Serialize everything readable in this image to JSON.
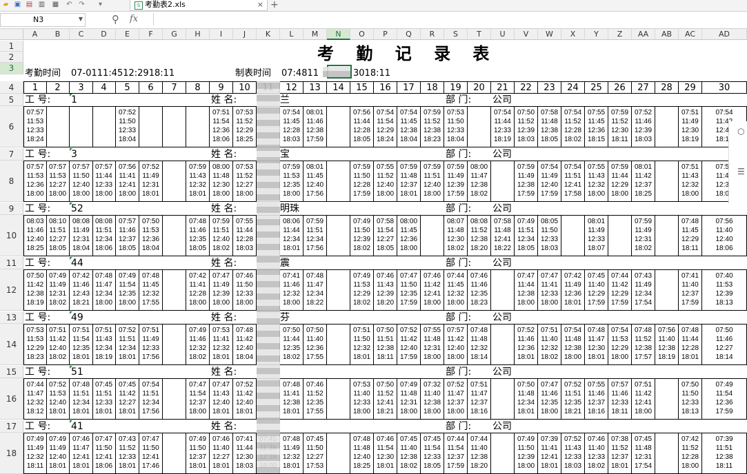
{
  "toolbar": {
    "icons": [
      "folder-open-icon",
      "save-icon",
      "export-icon",
      "print-icon",
      "print-preview-icon",
      "undo-icon",
      "redo-icon",
      "more-icon"
    ]
  },
  "tab": {
    "file_name": "考勤表2.xls",
    "close": "×",
    "add": "+"
  },
  "formula_bar": {
    "cell_ref": "N3",
    "fx": "fx",
    "value": ""
  },
  "columns": [
    "A",
    "B",
    "C",
    "D",
    "E",
    "F",
    "G",
    "H",
    "I",
    "J",
    "K",
    "L",
    "M",
    "N",
    "O",
    "P",
    "Q",
    "R",
    "S",
    "T",
    "U",
    "V",
    "W",
    "X",
    "Y",
    "Z",
    "AA",
    "AB",
    "AC",
    "AD"
  ],
  "selected_column": "N",
  "rows": [
    "1",
    "2",
    "3",
    "4",
    "5",
    "6",
    "7",
    "8",
    "9",
    "10",
    "11",
    "12",
    "13",
    "14",
    "15",
    "16",
    "17",
    "18"
  ],
  "selected_row": "3",
  "sheet": {
    "title": "考 勤 记 录 表",
    "attendance_time_label": "考勤时间",
    "attendance_time_value": "07-0111:4512:2918:11",
    "made_time_label": "制表时间",
    "made_time_value_a": "07:4811",
    "made_time_value_b": "3018:11",
    "days": [
      "1",
      "2",
      "3",
      "4",
      "5",
      "6",
      "7",
      "8",
      "9",
      "10",
      "11",
      "12",
      "13",
      "14",
      "15",
      "16",
      "17",
      "18",
      "19",
      "20",
      "21",
      "22",
      "23",
      "24",
      "25",
      "26",
      "27",
      "28",
      "29",
      "30"
    ],
    "emp_label": "工  号:",
    "name_label": "姓  名:",
    "dept_label": "部  门:",
    "dept_value": "公司",
    "employees": [
      {
        "id": "1",
        "name_tail": "兰",
        "punches": [
          "07:57\n11:53\n12:33\n18:24",
          "",
          "",
          "",
          "07:52\n11:50\n12:33\n18:04",
          "",
          "",
          "",
          "07:51\n11:54\n12:36\n18:06",
          "07:53\n11:52\n12:29\n18:25",
          "",
          "07:54\n11:45\n12:28\n18:03",
          "08:01\n11:46\n12:38\n17:59",
          "",
          "07:56\n11:44\n12:28\n18:05",
          "07:54\n11:54\n12:29\n18:24",
          "07:54\n11:45\n12:38\n18:04",
          "07:59\n11:52\n12:38\n18:23",
          "07:53\n11:50\n12:33\n18:04",
          "",
          "07:54\n11:44\n12:33\n18:19",
          "07:50\n11:52\n12:39\n18:03",
          "07:58\n11:48\n12:38\n18:05",
          "07:54\n11:52\n12:28\n18:02",
          "07:55\n11:45\n12:36\n18:15",
          "07:59\n11:52\n12:30\n18:11",
          "07:52\n11:46\n12:39\n18:03",
          "",
          "07:51\n11:49\n12:30\n18:19",
          "07:54\n11:42\n12:41\n18:12"
        ]
      },
      {
        "id": "3",
        "name_tail": "宝",
        "punches": [
          "07:57\n11:53\n12:36\n18:00",
          "07:57\n11:53\n12:27\n18:00",
          "07:57\n11:50\n12:40\n18:00",
          "07:57\n11:44\n12:33\n18:00",
          "07:56\n11:41\n12:41\n18:00",
          "07:52\n11:49\n12:31\n18:01",
          "",
          "07:59\n11:43\n12:32\n18:01",
          "08:00\n11:48\n12:30\n18:00",
          "07:53\n11:52\n12:27\n18:00",
          "",
          "07:59\n11:53\n12:35\n18:00",
          "08:01\n11:45\n12:40\n17:56",
          "",
          "07:59\n11:50\n12:28\n17:59",
          "07:55\n11:52\n12:40\n18:00",
          "07:59\n11:48\n12:37\n18:01",
          "07:59\n11:51\n12:40\n18:00",
          "07:59\n11:49\n12:39\n17:59",
          "08:00\n11:47\n12:38\n18:02",
          "",
          "07:59\n11:49\n12:38\n17:59",
          "07:54\n11:49\n12:40\n17:59",
          "07:54\n11:51\n12:41\n17:58",
          "07:55\n11:43\n12:32\n18:00",
          "07:59\n11:44\n12:29\n18:00",
          "08:01\n11:42\n12:37\n18:25",
          "",
          "07:51\n11:43\n12:32\n18:00",
          "07:58\n11:46\n12:36\n18:00"
        ]
      },
      {
        "id": "52",
        "name_tail": "明珠",
        "punches": [
          "08:03\n11:46\n12:40\n18:25",
          "08:10\n11:51\n12:27\n18:05",
          "08:08\n11:49\n12:31\n18:04",
          "08:08\n11:51\n12:34\n18:06",
          "07:57\n11:46\n12:37\n18:05",
          "07:50\n11:53\n12:36\n18:04",
          "",
          "07:48\n11:46\n12:35\n18:05",
          "07:59\n11:51\n12:40\n18:02",
          "07:55\n11:44\n12:28\n18:03",
          "",
          "08:06\n11:44\n12:34\n18:01",
          "07:59\n11:51\n12:34\n17:56",
          "",
          "07:49\n11:50\n12:39\n18:02",
          "07:58\n11:54\n12:27\n18:05",
          "08:00\n11:45\n12:36\n18:00",
          "",
          "08:07\n11:48\n12:30\n18:02",
          "08:08\n11:52\n12:38\n18:20",
          "07:58\n11:48\n12:41\n18:22",
          "07:49\n11:51\n12:34\n18:05",
          "08:05\n11:50\n12:33\n18:03",
          "",
          "08:01\n11:49\n12:33\n18:07",
          "",
          "07:59\n11:49\n12:31\n18:02",
          "",
          "07:48\n11:45\n12:29\n18:11",
          "07:56\n11:40\n12:40\n18:06"
        ]
      },
      {
        "id": "44",
        "name_tail": "震",
        "punches": [
          "07:50\n11:42\n12:38\n18:19",
          "07:49\n11:49\n12:31\n18:02",
          "07:42\n11:46\n12:43\n18:21",
          "07:48\n11:47\n12:34\n18:00",
          "07:49\n11:54\n12:35\n18:00",
          "07:48\n11:45\n12:32\n17:55",
          "",
          "07:42\n11:41\n12:28\n18:00",
          "07:47\n11:49\n12:39\n18:00",
          "07:46\n11:50\n12:33\n18:00",
          "",
          "07:41\n11:46\n12:32\n18:00",
          "07:48\n11:47\n12:34\n18:22",
          "",
          "07:49\n11:53\n12:29\n18:02",
          "07:46\n11:43\n12:39\n18:20",
          "07:47\n11:50\n12:35\n17:59",
          "07:46\n11:42\n12:41\n18:00",
          "07:44\n11:45\n12:32\n18:00",
          "07:46\n11:46\n12:35\n18:23",
          "",
          "07:47\n11:44\n12:38\n18:00",
          "07:47\n11:41\n12:33\n18:00",
          "07:42\n11:49\n12:36\n18:01",
          "07:45\n11:40\n12:29\n17:59",
          "07:44\n11:42\n12:29\n17:59",
          "07:43\n11:49\n12:34\n17:54",
          "",
          "07:41\n11:40\n12:37\n17:59",
          "07:40\n11:53\n12:39\n18:13"
        ]
      },
      {
        "id": "49",
        "name_tail": "芬",
        "punches": [
          "07:53\n11:53\n12:29\n18:23",
          "07:51\n11:42\n12:40\n18:02",
          "07:51\n11:54\n12:35\n18:01",
          "07:51\n11:43\n12:34\n18:19",
          "07:52\n11:51\n12:34\n18:01",
          "07:51\n11:49\n12:33\n17:56",
          "",
          "07:49\n11:46\n12:32\n18:02",
          "07:53\n11:41\n12:32\n18:01",
          "07:48\n11:42\n12:40\n18:04",
          "",
          "07:50\n11:44\n12:35\n18:02",
          "07:50\n11:40\n12:36\n17:55",
          "",
          "07:51\n11:50\n12:32\n18:01",
          "07:50\n11:51\n12:38\n18:11",
          "07:52\n11:42\n12:40\n17:59",
          "07:55\n11:48\n12:31\n18:00",
          "07:57\n11:42\n12:40\n18:00",
          "07:48\n11:48\n12:32\n18:14",
          "",
          "07:52\n11:46\n12:36\n18:01",
          "07:51\n11:40\n12:32\n18:02",
          "07:54\n11:48\n12:38\n18:00",
          "07:48\n11:47\n12:30\n18:01",
          "07:54\n11:53\n12:29\n18:00",
          "07:48\n11:52\n12:38\n17:57",
          "07:56\n11:40\n12:38\n18:19",
          "07:48\n11:44\n12:28\n18:01",
          "07:50\n11:46\n12:27\n18:14"
        ]
      },
      {
        "id": "51",
        "name_tail": "",
        "punches": [
          "07:44\n11:47\n12:32\n18:12",
          "07:52\n11:53\n12:40\n18:01",
          "07:48\n11:51\n12:34\n18:01",
          "07:45\n11:51\n12:33\n18:01",
          "07:45\n11:42\n12:27\n18:01",
          "07:54\n11:51\n12:34\n17:56",
          "",
          "07:47\n11:54\n12:37\n18:00",
          "07:47\n11:43\n12:40\n18:01",
          "07:52\n11:42\n12:40\n18:01",
          "",
          "07:48\n11:41\n12:38\n18:01",
          "07:46\n11:52\n12:35\n17:55",
          "",
          "07:53\n11:40\n12:33\n18:00",
          "07:50\n11:52\n12:41\n18:21",
          "07:49\n11:48\n12:31\n18:00",
          "07:32\n11:40\n12:38\n18:00",
          "07:52\n11:47\n12:37\n18:00",
          "07:51\n11:47\n12:37\n18:16",
          "",
          "07:50\n11:48\n12:34\n18:01",
          "07:47\n11:46\n12:35\n18:00",
          "07:52\n11:51\n12:35\n18:21",
          "07:55\n11:46\n12:37\n18:16",
          "07:57\n11:46\n12:33\n18:11",
          "07:51\n11:42\n12:41\n18:00",
          "",
          "07:50\n11:50\n12:33\n18:13",
          "07:49\n11:54\n12:36\n17:59"
        ]
      },
      {
        "id": "41",
        "name_tail": "",
        "punches": [
          "07:49\n11:49\n12:32\n18:11",
          "07:49\n11:49\n12:40\n18:01",
          "07:46\n11:47\n12:41\n18:01",
          "07:47\n11:50\n12:41\n18:06",
          "07:43\n11:52\n12:33\n18:01",
          "07:47\n11:50\n12:41\n17:46",
          "",
          "07:49\n11:50\n12:37\n18:01",
          "07:46\n11:40\n12:27\n18:01",
          "07:41\n11:44\n12:30\n18:03",
          "07:45\n11:39\n12:39\n18:00",
          "07:48\n11:49\n12:32\n18:01",
          "07:45\n11:50\n12:27\n17:53",
          "",
          "07:48\n11:48\n12:40\n18:25",
          "07:46\n11:54\n12:30\n18:01",
          "07:45\n11:40\n12:38\n18:02",
          "07:45\n11:54\n12:33\n18:05",
          "07:44\n11:54\n12:37\n17:59",
          "07:44\n11:40\n12:38\n18:20",
          "",
          "07:49\n11:50\n12:39\n18:00",
          "07:39\n11:41\n12:41\n18:01",
          "07:52\n11:43\n12:33\n18:03",
          "07:46\n11:40\n12:33\n18:02",
          "07:38\n11:52\n12:37\n18:01",
          "07:45\n11:48\n12:31\n17:54",
          "",
          "07:42\n11:52\n12:28\n18:00",
          "07:39\n11:51\n12:38\n18:11"
        ]
      }
    ]
  }
}
